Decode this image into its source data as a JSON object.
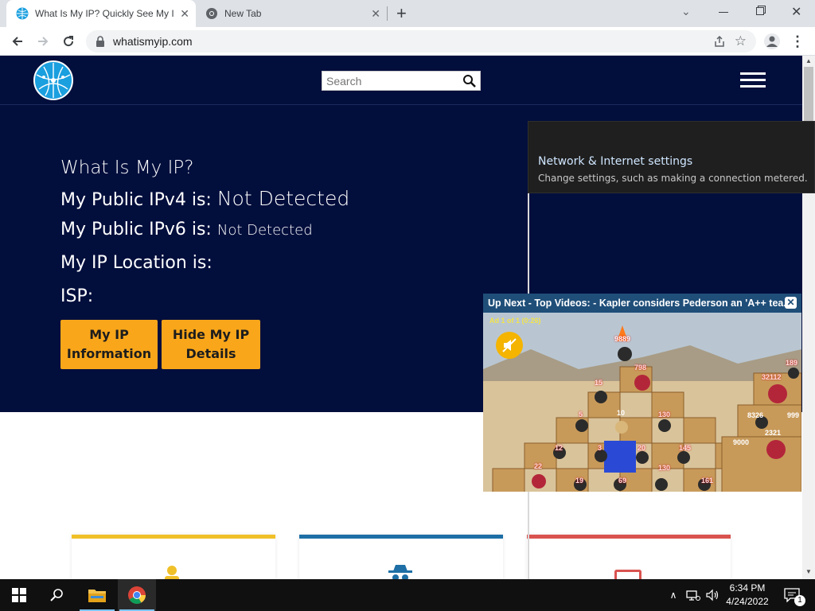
{
  "browser": {
    "tabs": [
      {
        "title": "What Is My IP? Quickly See My IP"
      },
      {
        "title": "New Tab"
      }
    ],
    "url": "whatismyip.com"
  },
  "site": {
    "search_placeholder": "Search",
    "heading": "What Is My IP?",
    "ipv4_label": "My Public IPv4 is:",
    "ipv4_value": "Not Detected",
    "ipv6_label": "My Public IPv6 is:",
    "ipv6_value": "Not Detected",
    "location_label": "My IP Location is:",
    "isp_label": "ISP:",
    "buttons": [
      {
        "line1": "My IP",
        "line2": "Information"
      },
      {
        "line1": "Hide My IP",
        "line2": "Details"
      }
    ],
    "card_colors": [
      "#f0c029",
      "#1d6fa5",
      "#d9534f"
    ]
  },
  "network_tooltip": {
    "title": "Network & Internet settings",
    "subtitle": "Change settings, such as making a connection metered."
  },
  "video": {
    "header": "Up Next - Top Videos: - Kapler considers Pederson an 'A++ tea...",
    "ad_label": "Ad 1 of 1 (0:26)",
    "scores": [
      "9889",
      "798",
      "15",
      "5",
      "10",
      "130",
      "12",
      "3",
      "20",
      "145",
      "22",
      "19",
      "69",
      "130",
      "161",
      "189",
      "32112",
      "8326",
      "999",
      "2321",
      "9000"
    ]
  },
  "taskbar": {
    "time": "6:34 PM",
    "date": "4/24/2022",
    "notification_count": "1"
  }
}
